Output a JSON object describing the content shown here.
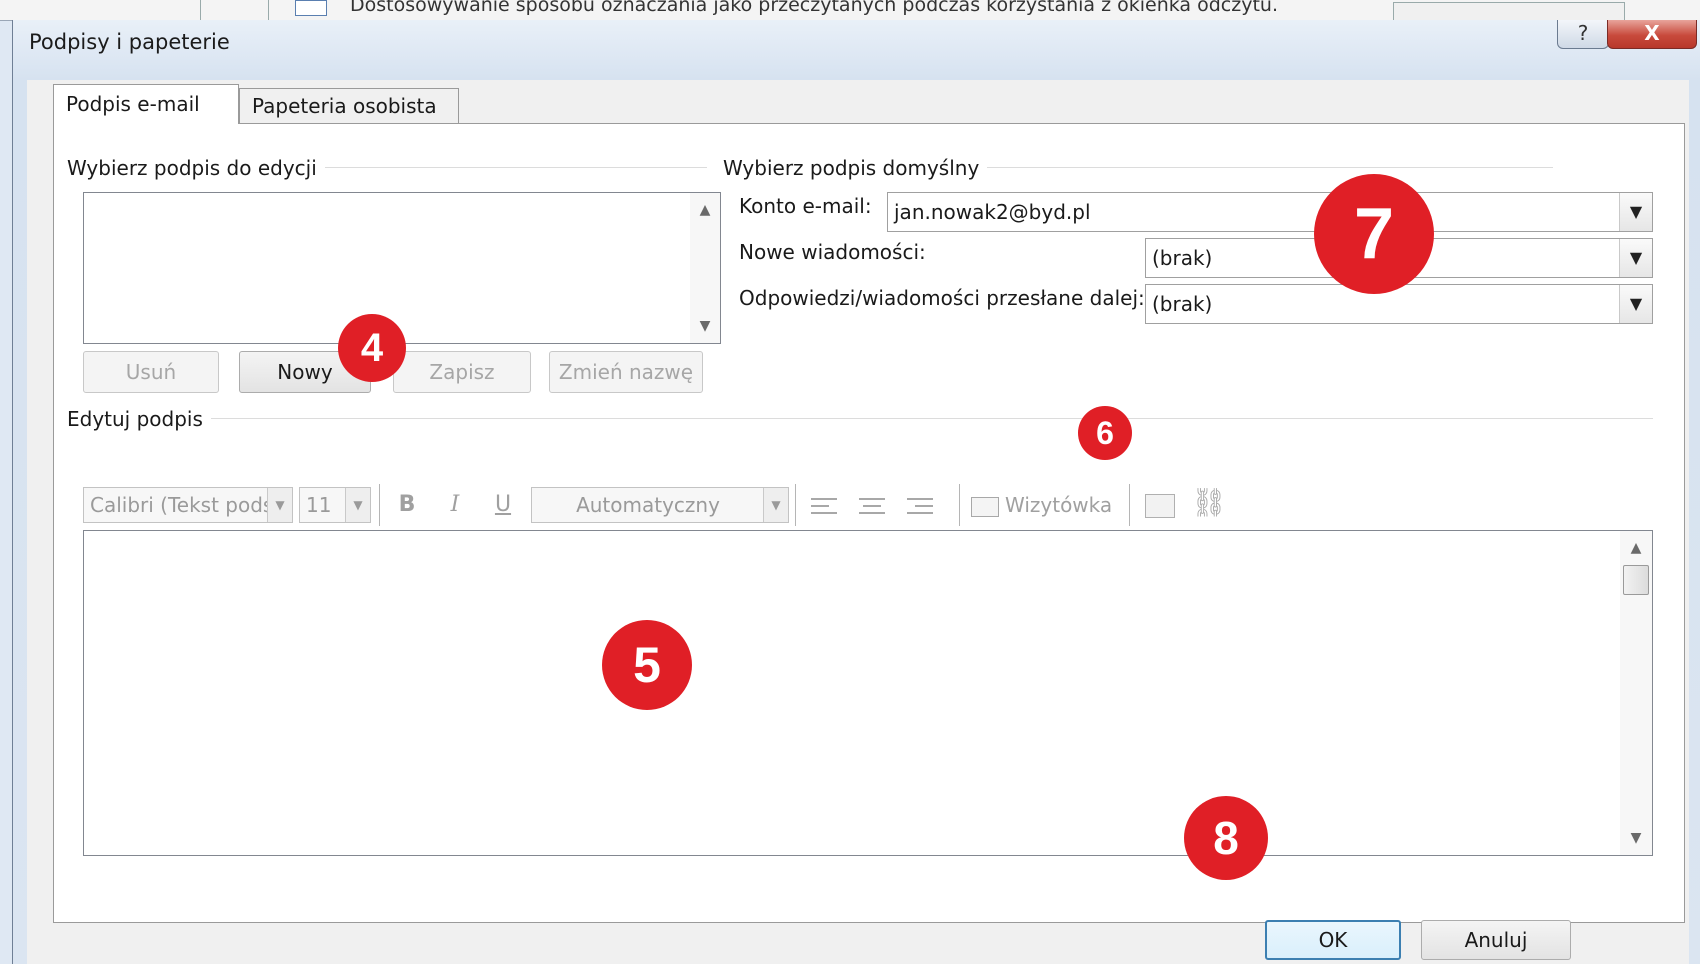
{
  "background": {
    "text": "Dostosowywanie sposobu oznaczania jako przeczytanych podczas korzystania z okienka odczytu."
  },
  "window": {
    "title": "Podpisy i papeterie",
    "help_glyph": "?",
    "close_glyph": "X"
  },
  "tabs": [
    {
      "label": "Podpis e-mail",
      "active": true
    },
    {
      "label": "Papeteria osobista",
      "active": false
    }
  ],
  "edit_select": {
    "group_label": "Wybierz podpis do edycji",
    "buttons": {
      "delete": "Usuń",
      "new": "Nowy",
      "save": "Zapisz",
      "rename": "Zmień nazwę"
    }
  },
  "default_signature": {
    "group_label": "Wybierz podpis domyślny",
    "account_label": "Konto e-mail:",
    "account_value": "jan.nowak2@byd.pl",
    "new_messages_label": "Nowe wiadomości:",
    "new_messages_value": "(brak)",
    "replies_label": "Odpowiedzi/wiadomości przesłane dalej:",
    "replies_value": "(brak)"
  },
  "editor": {
    "group_label": "Edytuj podpis",
    "font": "Calibri (Tekst pods",
    "size": "11",
    "bold": "B",
    "italic": "I",
    "underline": "U",
    "color": "Automatyczny",
    "business_card": "Wizytówka"
  },
  "footer": {
    "ok": "OK",
    "cancel": "Anuluj"
  },
  "callouts": [
    "4",
    "5",
    "6",
    "7",
    "8"
  ],
  "colors": {
    "callout": "#e01f26",
    "close_button": "#c84a3c",
    "default_button_border": "#3c7fb1"
  }
}
